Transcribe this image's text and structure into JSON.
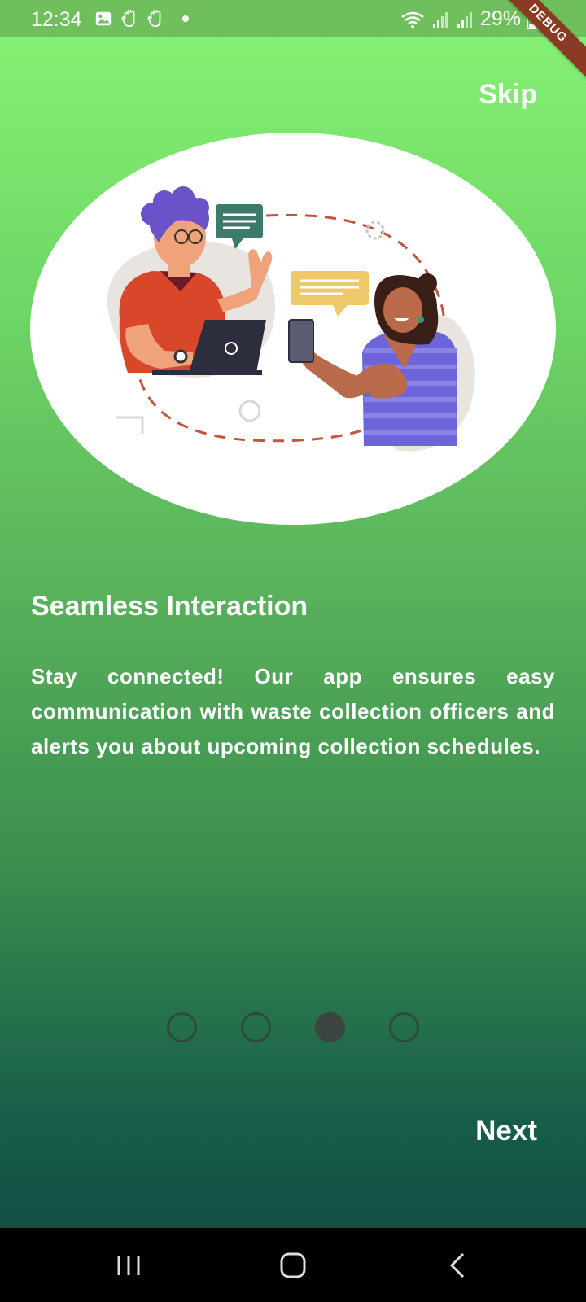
{
  "status_bar": {
    "time": "12:34",
    "battery": "29%",
    "icons": [
      "image-icon",
      "hand-icon",
      "hand-icon",
      "wifi-icon",
      "signal-icon",
      "signal-icon",
      "battery-icon"
    ]
  },
  "debug_banner": "DEBUG",
  "onboarding": {
    "skip_label": "Skip",
    "title": "Seamless Interaction",
    "description": "Stay connected! Our app ensures easy communication with waste collection officers and alerts you about upcoming collection schedules.",
    "page_indicator": {
      "total": 4,
      "current": 3
    },
    "next_label": "Next"
  },
  "nav_bar": {
    "buttons": [
      "recent-apps-icon",
      "home-icon",
      "back-icon"
    ]
  },
  "colors": {
    "gradient_top": "#86f374",
    "gradient_bottom": "#124f44",
    "status_bar": "#6fbf5c",
    "dot_inactive_border": "#2f4a3a",
    "dot_active": "#3c4540"
  }
}
